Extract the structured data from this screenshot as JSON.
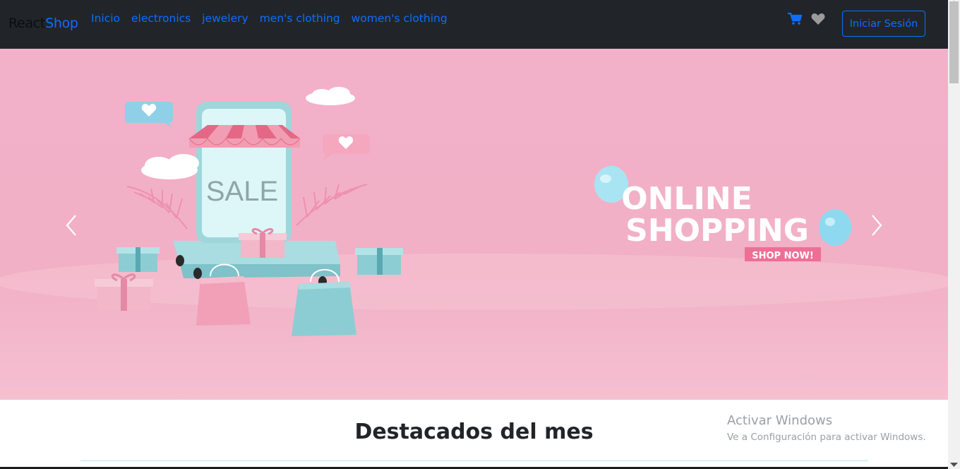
{
  "navbar": {
    "brand_part1": "React",
    "brand_part2": "Shop",
    "links": [
      "Inicio",
      "electronics",
      "jewelery",
      "men's clothing",
      "women's clothing"
    ],
    "login_label": "Iniciar Sesión",
    "icons": [
      "cart-icon",
      "heart-icon"
    ]
  },
  "hero": {
    "sale_text": "SALE",
    "line1": "ONLINE",
    "line2": "SHOPPING",
    "badge": "SHOP NOW!",
    "icons": [
      "chevron-left-icon",
      "chevron-right-icon"
    ]
  },
  "section": {
    "title": "Destacados del mes"
  },
  "watermark": {
    "title": "Activar Windows",
    "subtitle": "Ve a Configuración para activar Windows."
  },
  "colors": {
    "navbar_bg": "#212529",
    "link": "#0d6efd",
    "hero_bg": "#f3b1c9",
    "teal": "#9fd6dc",
    "pink": "#e8758f"
  }
}
